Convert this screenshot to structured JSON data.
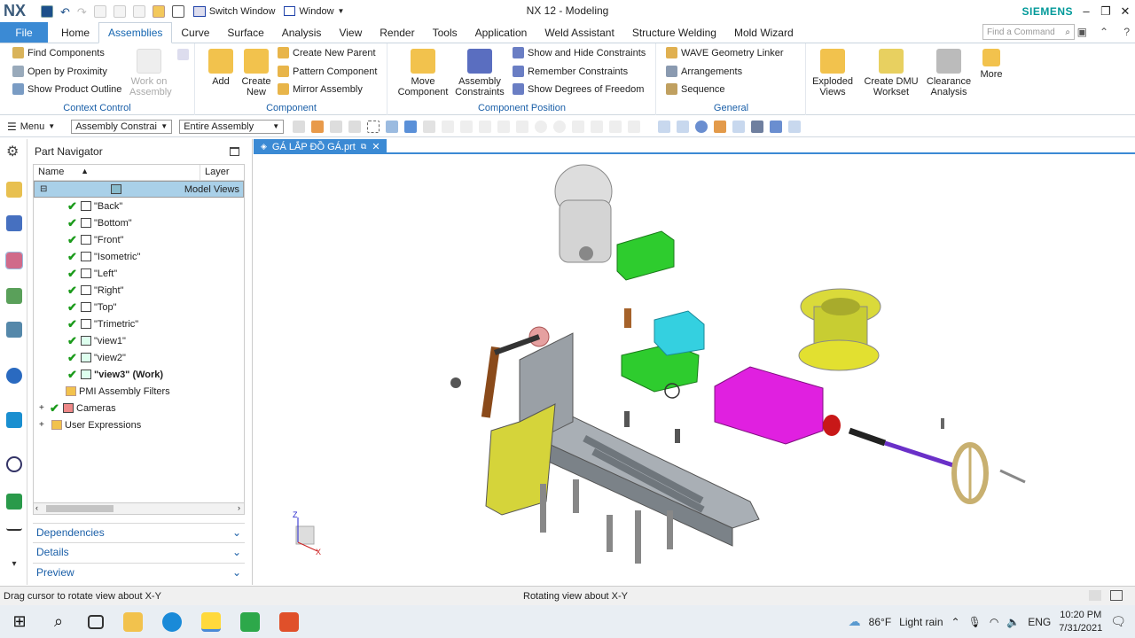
{
  "app": {
    "logo": "NX",
    "title": "NX 12 - Modeling",
    "brand": "SIEMENS",
    "switch_window": "Switch Window",
    "window_menu": "Window"
  },
  "tabs": [
    "File",
    "Home",
    "Assemblies",
    "Curve",
    "Surface",
    "Analysis",
    "View",
    "Render",
    "Tools",
    "Application",
    "Weld Assistant",
    "Structure Welding",
    "Mold Wizard"
  ],
  "find_command": "Find a Command",
  "ribbon": {
    "context_control": {
      "label": "Context Control",
      "find_components": "Find Components",
      "open_by_proximity": "Open by Proximity",
      "show_product_outline": "Show Product Outline",
      "work_on_assembly": "Work on Assembly"
    },
    "component": {
      "label": "Component",
      "add": "Add",
      "create_new": "Create New",
      "create_new_parent": "Create New Parent",
      "pattern_component": "Pattern Component",
      "mirror_assembly": "Mirror Assembly"
    },
    "component_position": {
      "label": "Component Position",
      "move_component": "Move Component",
      "assembly_constraints": "Assembly Constraints",
      "show_hide_constraints": "Show and Hide Constraints",
      "remember_constraints": "Remember Constraints",
      "show_dof": "Show Degrees of Freedom"
    },
    "general": {
      "label": "General",
      "wave_linker": "WAVE Geometry Linker",
      "arrangements": "Arrangements",
      "sequence": "Sequence"
    },
    "exploded_views": "Exploded Views",
    "create_dmu_workset": "Create DMU Workset",
    "clearance_analysis": "Clearance Analysis",
    "more": "More"
  },
  "toolbar2": {
    "menu": "Menu",
    "filter": "Assembly Constrai",
    "scope": "Entire Assembly"
  },
  "part_navigator": {
    "title": "Part Navigator",
    "col_name": "Name",
    "col_layer": "Layer",
    "items": [
      {
        "label": "Model Views"
      },
      {
        "label": "\"Back\""
      },
      {
        "label": "\"Bottom\""
      },
      {
        "label": "\"Front\""
      },
      {
        "label": "\"Isometric\""
      },
      {
        "label": "\"Left\""
      },
      {
        "label": "\"Right\""
      },
      {
        "label": "\"Top\""
      },
      {
        "label": "\"Trimetric\""
      },
      {
        "label": "\"view1\""
      },
      {
        "label": "\"view2\""
      },
      {
        "label": "\"view3\" (Work)"
      },
      {
        "label": "PMI Assembly Filters"
      },
      {
        "label": "Cameras"
      },
      {
        "label": "User Expressions"
      }
    ],
    "dependencies": "Dependencies",
    "details": "Details",
    "preview": "Preview"
  },
  "file_tab": "GÁ LẮP ĐỒ GÁ.prt",
  "status": {
    "left": "Drag cursor to rotate view about X-Y",
    "center": "Rotating view about X-Y"
  },
  "taskbar": {
    "temperature": "86°F",
    "weather": "Light rain",
    "lang": "ENG",
    "time": "10:20 PM",
    "date": "7/31/2021"
  },
  "axis": {
    "z": "Z",
    "x": "X"
  },
  "colors": {
    "accent": "#3b8ad4",
    "ribbon_label": "#1a5fa8",
    "brand": "#009999"
  }
}
